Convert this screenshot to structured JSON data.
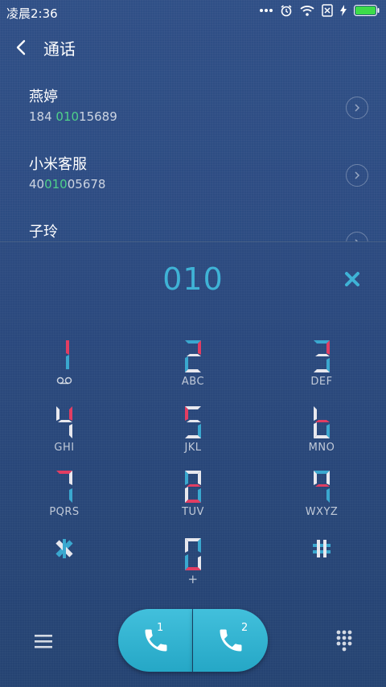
{
  "status_bar": {
    "time": "凌晨2:36",
    "icons": [
      "more-icon",
      "alarm-icon",
      "wifi-icon",
      "no-sim-icon",
      "charging-icon",
      "battery-icon"
    ]
  },
  "header": {
    "title": "通话",
    "back_icon": "chevron-left-icon"
  },
  "contacts": [
    {
      "name": "燕婷",
      "number_pre": "184 ",
      "number_match": "010",
      "number_post": "15689"
    },
    {
      "name": "小米客服",
      "number_pre": "40",
      "number_match": "010",
      "number_post": "05678"
    },
    {
      "name": "子玲",
      "number_pre": "",
      "number_match": "",
      "number_post": ""
    }
  ],
  "dialpad": {
    "dialed": "010",
    "keys": [
      {
        "digit": "1",
        "letters": ""
      },
      {
        "digit": "2",
        "letters": "ABC"
      },
      {
        "digit": "3",
        "letters": "DEF"
      },
      {
        "digit": "4",
        "letters": "GHI"
      },
      {
        "digit": "5",
        "letters": "JKL"
      },
      {
        "digit": "6",
        "letters": "MNO"
      },
      {
        "digit": "7",
        "letters": "PQRS"
      },
      {
        "digit": "8",
        "letters": "TUV"
      },
      {
        "digit": "9",
        "letters": "WXYZ"
      },
      {
        "digit": "*",
        "letters": ""
      },
      {
        "digit": "0",
        "letters": "+"
      },
      {
        "digit": "#",
        "letters": ""
      }
    ]
  },
  "bottom": {
    "sim1": "1",
    "sim2": "2"
  },
  "colors": {
    "accent": "#3fb3d6",
    "match": "#4fd08a",
    "call": "#2fb3d1",
    "segment_red": "#e23d62",
    "segment_blue": "#3aa8cf"
  }
}
